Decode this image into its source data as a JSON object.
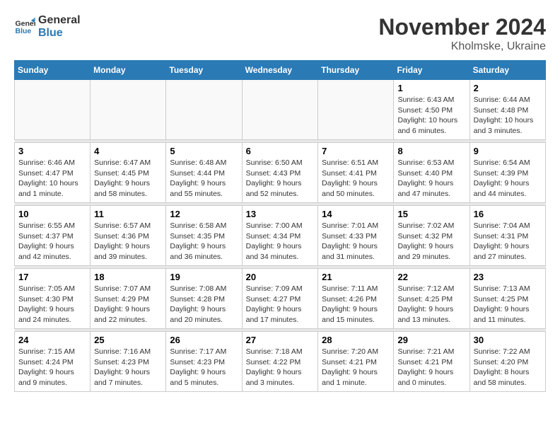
{
  "logo": {
    "line1": "General",
    "line2": "Blue"
  },
  "header": {
    "month_year": "November 2024",
    "location": "Kholmske, Ukraine"
  },
  "weekdays": [
    "Sunday",
    "Monday",
    "Tuesday",
    "Wednesday",
    "Thursday",
    "Friday",
    "Saturday"
  ],
  "weeks": [
    [
      {
        "day": "",
        "info": ""
      },
      {
        "day": "",
        "info": ""
      },
      {
        "day": "",
        "info": ""
      },
      {
        "day": "",
        "info": ""
      },
      {
        "day": "",
        "info": ""
      },
      {
        "day": "1",
        "info": "Sunrise: 6:43 AM\nSunset: 4:50 PM\nDaylight: 10 hours and 6 minutes."
      },
      {
        "day": "2",
        "info": "Sunrise: 6:44 AM\nSunset: 4:48 PM\nDaylight: 10 hours and 3 minutes."
      }
    ],
    [
      {
        "day": "3",
        "info": "Sunrise: 6:46 AM\nSunset: 4:47 PM\nDaylight: 10 hours and 1 minute."
      },
      {
        "day": "4",
        "info": "Sunrise: 6:47 AM\nSunset: 4:45 PM\nDaylight: 9 hours and 58 minutes."
      },
      {
        "day": "5",
        "info": "Sunrise: 6:48 AM\nSunset: 4:44 PM\nDaylight: 9 hours and 55 minutes."
      },
      {
        "day": "6",
        "info": "Sunrise: 6:50 AM\nSunset: 4:43 PM\nDaylight: 9 hours and 52 minutes."
      },
      {
        "day": "7",
        "info": "Sunrise: 6:51 AM\nSunset: 4:41 PM\nDaylight: 9 hours and 50 minutes."
      },
      {
        "day": "8",
        "info": "Sunrise: 6:53 AM\nSunset: 4:40 PM\nDaylight: 9 hours and 47 minutes."
      },
      {
        "day": "9",
        "info": "Sunrise: 6:54 AM\nSunset: 4:39 PM\nDaylight: 9 hours and 44 minutes."
      }
    ],
    [
      {
        "day": "10",
        "info": "Sunrise: 6:55 AM\nSunset: 4:37 PM\nDaylight: 9 hours and 42 minutes."
      },
      {
        "day": "11",
        "info": "Sunrise: 6:57 AM\nSunset: 4:36 PM\nDaylight: 9 hours and 39 minutes."
      },
      {
        "day": "12",
        "info": "Sunrise: 6:58 AM\nSunset: 4:35 PM\nDaylight: 9 hours and 36 minutes."
      },
      {
        "day": "13",
        "info": "Sunrise: 7:00 AM\nSunset: 4:34 PM\nDaylight: 9 hours and 34 minutes."
      },
      {
        "day": "14",
        "info": "Sunrise: 7:01 AM\nSunset: 4:33 PM\nDaylight: 9 hours and 31 minutes."
      },
      {
        "day": "15",
        "info": "Sunrise: 7:02 AM\nSunset: 4:32 PM\nDaylight: 9 hours and 29 minutes."
      },
      {
        "day": "16",
        "info": "Sunrise: 7:04 AM\nSunset: 4:31 PM\nDaylight: 9 hours and 27 minutes."
      }
    ],
    [
      {
        "day": "17",
        "info": "Sunrise: 7:05 AM\nSunset: 4:30 PM\nDaylight: 9 hours and 24 minutes."
      },
      {
        "day": "18",
        "info": "Sunrise: 7:07 AM\nSunset: 4:29 PM\nDaylight: 9 hours and 22 minutes."
      },
      {
        "day": "19",
        "info": "Sunrise: 7:08 AM\nSunset: 4:28 PM\nDaylight: 9 hours and 20 minutes."
      },
      {
        "day": "20",
        "info": "Sunrise: 7:09 AM\nSunset: 4:27 PM\nDaylight: 9 hours and 17 minutes."
      },
      {
        "day": "21",
        "info": "Sunrise: 7:11 AM\nSunset: 4:26 PM\nDaylight: 9 hours and 15 minutes."
      },
      {
        "day": "22",
        "info": "Sunrise: 7:12 AM\nSunset: 4:25 PM\nDaylight: 9 hours and 13 minutes."
      },
      {
        "day": "23",
        "info": "Sunrise: 7:13 AM\nSunset: 4:25 PM\nDaylight: 9 hours and 11 minutes."
      }
    ],
    [
      {
        "day": "24",
        "info": "Sunrise: 7:15 AM\nSunset: 4:24 PM\nDaylight: 9 hours and 9 minutes."
      },
      {
        "day": "25",
        "info": "Sunrise: 7:16 AM\nSunset: 4:23 PM\nDaylight: 9 hours and 7 minutes."
      },
      {
        "day": "26",
        "info": "Sunrise: 7:17 AM\nSunset: 4:23 PM\nDaylight: 9 hours and 5 minutes."
      },
      {
        "day": "27",
        "info": "Sunrise: 7:18 AM\nSunset: 4:22 PM\nDaylight: 9 hours and 3 minutes."
      },
      {
        "day": "28",
        "info": "Sunrise: 7:20 AM\nSunset: 4:21 PM\nDaylight: 9 hours and 1 minute."
      },
      {
        "day": "29",
        "info": "Sunrise: 7:21 AM\nSunset: 4:21 PM\nDaylight: 9 hours and 0 minutes."
      },
      {
        "day": "30",
        "info": "Sunrise: 7:22 AM\nSunset: 4:20 PM\nDaylight: 8 hours and 58 minutes."
      }
    ]
  ]
}
